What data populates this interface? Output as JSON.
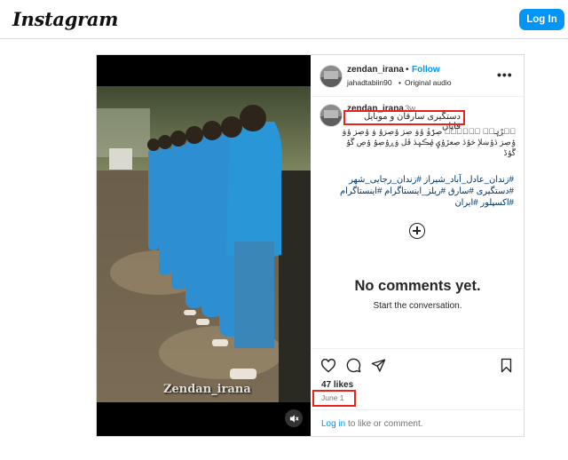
{
  "header": {
    "logo": "Instagram",
    "login_label": "Log In"
  },
  "post": {
    "username": "zendan_irana",
    "dot": "•",
    "follow_label": "Follow",
    "audio_user": "jahadtabiin90",
    "audio_dot": "•",
    "audio_label": "Original audio",
    "more_label": "•••",
    "caption_user": "zendan_irana",
    "caption_age": "3w",
    "caption_line1": "دستگیری سارقان و موبایل قاپان",
    "caption_fancy": "مۘڔْۑۼۘ ۑۧۗۏۡۖ ڝڗۢۏْ ۏۢۏ ڝڗ ۏۢڝڗۏۢ ۏ ۏۢڝڗ ۏۢۏ ۏۢڝڗ ڎۏۢښلإ ڂۏۢڎ ڝعڒۏۢۑ ڝۢڪۑڎ ڦل ۏڕۏۢڝۏۢ ۏۢڝ ڱۏۢ ڴۏۢڈ",
    "tags": [
      "#زندان_عادل_آباد_شیراز",
      "#زندان_رجایی_شهر",
      "#دستگیری",
      "#سارق",
      "#ریلز_اینستاگرام",
      "#اینستاگرام",
      "#اکسپلور",
      "#ایران"
    ],
    "no_comments": "No comments yet.",
    "start_conversation": "Start the conversation.",
    "likes": "47 likes",
    "date": "June 1",
    "footer_login": "Log in",
    "footer_rest": " to like or comment."
  },
  "video": {
    "watermark": "Zendan_irana"
  },
  "colors": {
    "accent": "#0095f6",
    "highlight": "#e8231c"
  },
  "icons": [
    "heart-icon",
    "comment-icon",
    "share-icon",
    "bookmark-icon",
    "more-icon",
    "mute-icon",
    "add-comment-icon"
  ]
}
